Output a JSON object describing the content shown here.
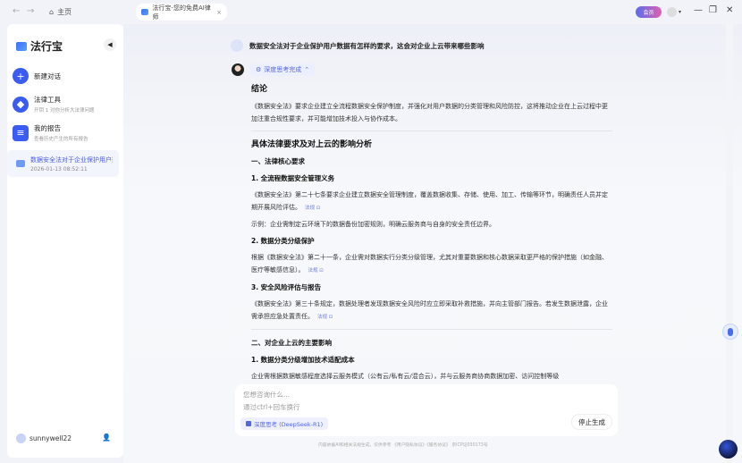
{
  "topbar": {
    "home": "主页",
    "tab_title": "法行宝-您的免费AI律师",
    "tab_close": "×",
    "vip": "会员",
    "minimize": "—",
    "restore": "❐",
    "close": "✕",
    "back": "←",
    "forward": "→"
  },
  "sidebar": {
    "brand": "法行宝",
    "collapse": "◀",
    "items": [
      {
        "title": "新建对话",
        "icon": "+"
      },
      {
        "title": "法律工具",
        "sub": "开钥 1 对你分析大法律问题",
        "icon": "◆"
      },
      {
        "title": "我的报告",
        "sub": "查看历史产生的所有报告",
        "icon": "≡"
      }
    ],
    "history": [
      {
        "title": "数据安全法对于企业保护用户数据有怎样的要求，这会对企业上云带来哪些影响",
        "date": "2026-01-13 08:52:11"
      }
    ],
    "user": "sunnywell22"
  },
  "chat": {
    "question": "数据安全法对于企业保护用户数据有怎样的要求，这会对企业上云带来哪些影响",
    "think_label": "深度思考完成",
    "conclusion_title": "结论",
    "conclusion": "《数据安全法》要求企业建立全流程数据安全保护制度，并强化对用户数据的分类管理和风险防控，这将推动企业在上云过程中更加注重合规性要求，并可能增加技术投入与协作成本。",
    "analysis_title": "具体法律要求及对上云的影响分析",
    "s1": "一、法律核心要求",
    "s1_1": "1. 全流程数据安全管理义务",
    "s1_1_p": "《数据安全法》第二十七条要求企业建立数据安全管理制度，覆盖数据收集、存储、使用、加工、传输等环节，明确责任人员并定期开展风险评估。",
    "s1_1_ex": "示例：企业需制定云环境下的数据备份加密规则，明确云服务商与自身的安全责任边界。",
    "s1_2": "2. 数据分类分级保护",
    "s1_2_p": "根据《数据安全法》第二十一条，企业需对数据实行分类分级管理，尤其对重要数据和核心数据采取更严格的保护措施（如金融、医疗等敏感信息）。",
    "s1_3": "3. 安全风险评估与报告",
    "s1_3_p": "《数据安全法》第三十条规定，数据处理者发现数据安全风险时应立即采取补救措施，并向主管部门报告。若发生数据泄露，企业需承担应急处置责任。",
    "s2": "二、对企业上云的主要影响",
    "s2_1": "1. 数据分类分级增加技术适配成本",
    "s2_1_p": "企业需根据数据敏感程度选择云服务模式（公有云/私有云/混合云），并与云服务商协商数据加密、访问控制等级",
    "ref": "法规 ⊡"
  },
  "input": {
    "placeholder1": "您想咨询什么...",
    "placeholder2": "通过ctrl+回车换行",
    "deep_mode": "深度思考 (DeepSeek-R1)",
    "stop": "停止生成"
  },
  "footer": "内容依据AI和相关法规生成，仅供参考 《用户隐私协议》《服务协议》 京ICP证030173号"
}
